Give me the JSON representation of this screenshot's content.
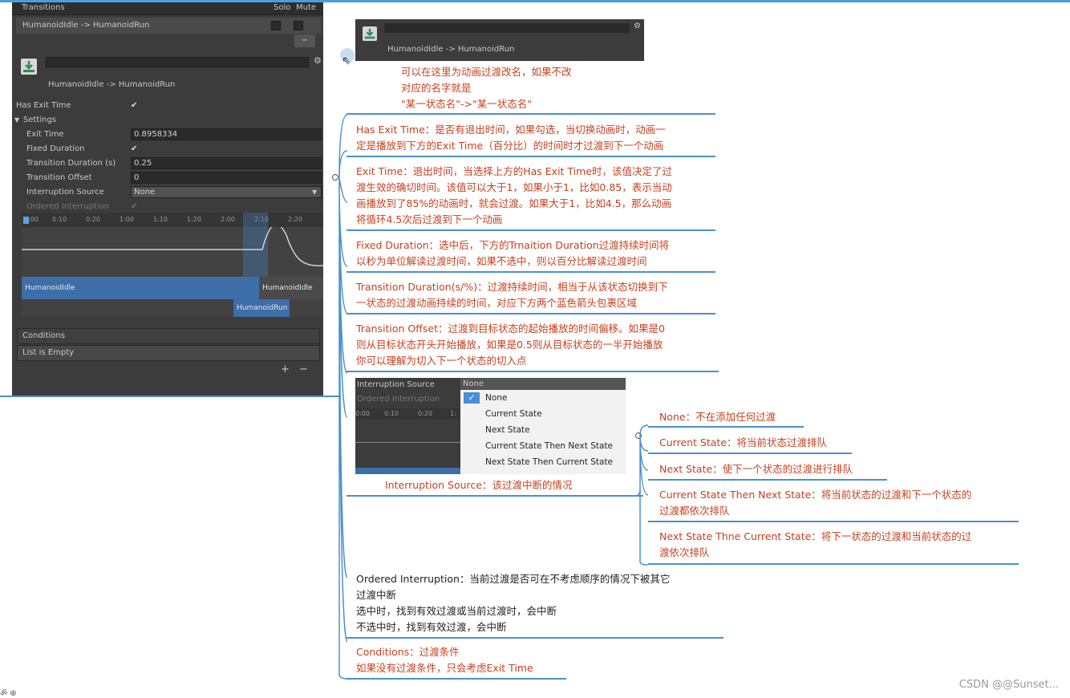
{
  "inspector": {
    "transitions_header": "Transitions",
    "solo": "Solo",
    "mute": "Mute",
    "transition_name": "HumanoidIdle -> HumanoidRun",
    "minus": "−",
    "subtitle": "HumanoidIdle -> HumanoidRun",
    "has_exit_time": "Has Exit Time",
    "settings": "Settings",
    "exit_time": "Exit Time",
    "exit_time_value": "0.8958334",
    "fixed_duration": "Fixed Duration",
    "transition_duration": "Transition Duration (s)",
    "transition_duration_value": "0.25",
    "transition_offset": "Transition Offset",
    "transition_offset_value": "0",
    "interruption_source": "Interruption Source",
    "interruption_source_value": "None",
    "ordered_interruption": "Ordered Interruption",
    "ruler": [
      "0:00",
      "0:10",
      "0:20",
      "1:00",
      "1:10",
      "1:20",
      "2:00",
      "2:10",
      "2:20"
    ],
    "bar_idle": "HumanoidIdle",
    "bar_idle2": "HumanoidIdle",
    "bar_run": "HumanoidRun",
    "conditions": "Conditions",
    "list_empty": "List is Empty",
    "plus": "+",
    "minus2": "−",
    "checkmark": "✔"
  },
  "topcap": {
    "label": "HumanoidIdle -> HumanoidRun"
  },
  "notes": {
    "rename": [
      "可以在这里为动画过渡改名，如果不改",
      "对应的名字就是",
      "\"某一状态名\"->\"某一状态名\""
    ],
    "has_exit": [
      "Has Exit Time：是否有退出时间，如果勾选，当切换动画时，动画一",
      "定是播放到下方的Exit Time（百分比）的时间时才过渡到下一个动画"
    ],
    "exit_time": [
      "Exit Time：退出时间，当选择上方的Has Exit Time时，该值决定了过",
      "渡生效的确切时间。该值可以大于1，如果小于1，比如0.85，表示当动",
      "画播放到了85%的动画时，就会过渡。如果大于1，比如4.5，那么动画",
      "将循环4.5次后过渡到下一个动画"
    ],
    "fixed": [
      "Fixed Duration：选中后，下方的Trnaition Duration过渡持续时间将",
      "以秒为单位解读过渡时间，如果不选中，则以百分比解读过渡时间"
    ],
    "duration": [
      "Transition Duration(s/%)：过渡持续时间，相当于从该状态切换到下",
      "一状态的过渡动画持续的时间，对应下方两个蓝色箭头包裹区域"
    ],
    "offset": [
      "Transition Offset：过渡到目标状态的起始播放的时间偏移。如果是0",
      "则从目标状态开头开始播放，如果是0.5则从目标状态的一半开始播放",
      "你可以理解为切入下一个状态的切入点"
    ],
    "interruption_caption": "Interruption Source：该过渡中断的情况",
    "none": "None：不在添加任何过渡",
    "current": "Current State：将当前状态过渡排队",
    "next": "Next State：使下一个状态的过渡进行排队",
    "cur_next": [
      "Current State Then Next State：将当前状态的过渡和下一个状态的",
      "过渡都依次排队"
    ],
    "next_cur": [
      "Next State Thne Current State：将下一状态的过渡和当前状态的过",
      "渡依次排队"
    ],
    "ordered": [
      "Ordered Interruption：当前过渡是否可在不考虑顺序的情况下被其它",
      "过渡中断",
      "选中时，找到有效过渡或当前过渡时，会中断",
      "不选中时，找到有效过渡，会中断"
    ],
    "conditions": [
      "Conditions：过渡条件",
      "如果没有过渡条件，只会考虑Exit Time"
    ]
  },
  "popup": {
    "source": "Interruption Source",
    "value": "None",
    "ordered": "Ordered Interruption",
    "ruler": [
      "0:00",
      "0:10",
      "0:20",
      "1:"
    ],
    "options": [
      "None",
      "Current State",
      "Next State",
      "Current State Then Next State",
      "Next State Then Current State"
    ],
    "check": "✓"
  },
  "footer": {
    "csdn": "CSDN @@Sunset...",
    "bl": "ॐ ⊕"
  }
}
